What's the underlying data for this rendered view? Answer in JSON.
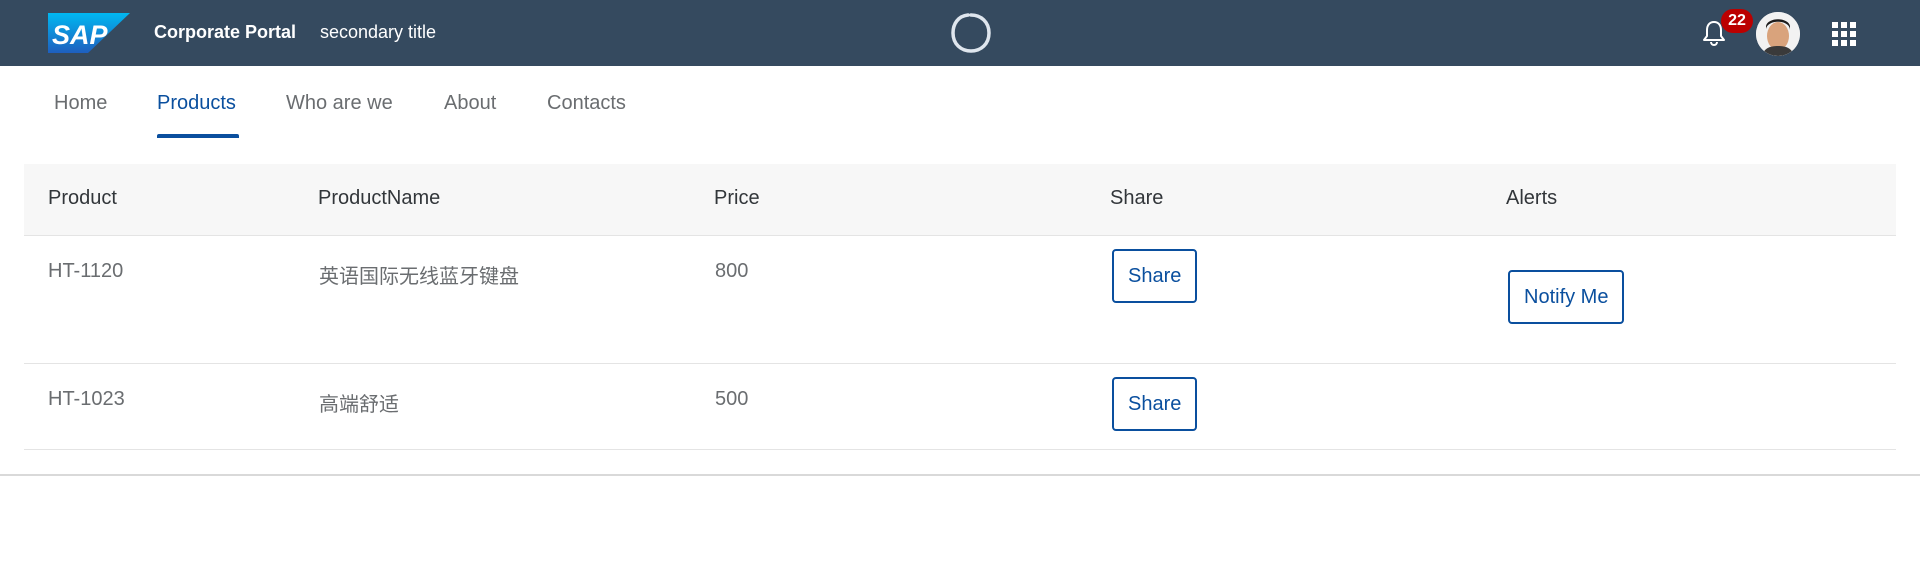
{
  "shellbar": {
    "logo_text": "SAP",
    "title": "Corporate Portal",
    "subtitle": "secondary title",
    "notification_count": "22",
    "colors": {
      "background": "#354a5f",
      "badge": "#bb0000"
    },
    "icons": [
      "sap-logo",
      "copilot-icon",
      "bell-icon",
      "avatar",
      "product-switch-grid-icon"
    ]
  },
  "tabs": [
    {
      "label": "Home",
      "active": false
    },
    {
      "label": "Products",
      "active": true
    },
    {
      "label": "Who are we",
      "active": false
    },
    {
      "label": "About",
      "active": false
    },
    {
      "label": "Contacts",
      "active": false
    }
  ],
  "table": {
    "headers": [
      "Product",
      "ProductName",
      "Price",
      "Share",
      "Alerts"
    ],
    "rows": [
      {
        "product": "HT-1120",
        "name": "英语国际无线蓝牙键盘",
        "price": "800",
        "share_label": "Share",
        "alert_label": "Notify Me"
      },
      {
        "product": "HT-1023",
        "name": "高端舒适",
        "price": "500",
        "share_label": "Share",
        "alert_label": ""
      }
    ]
  },
  "accent_color": "#0a4f9e"
}
